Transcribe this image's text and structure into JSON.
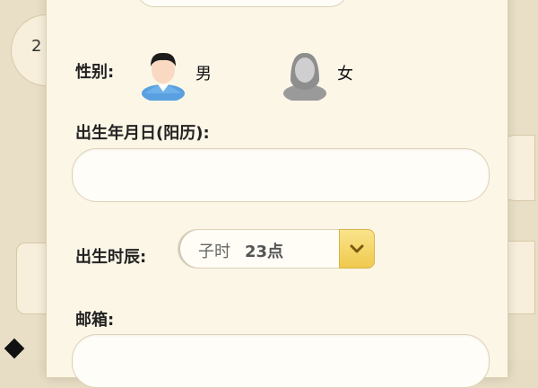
{
  "background": {
    "card_number": "2"
  },
  "form": {
    "gender_label": "性别:",
    "gender_options": [
      {
        "label": "男",
        "icon": "male-avatar-icon"
      },
      {
        "label": "女",
        "icon": "female-avatar-icon"
      }
    ],
    "birthdate_label": "出生年月日(阳历):",
    "birthdate_value": "",
    "birth_hour_label": "出生时辰:",
    "birth_hour_value": "子时",
    "birth_hour_detail": "23点",
    "email_label": "邮箱:",
    "email_value": ""
  },
  "colors": {
    "accent": "#f0c94e",
    "panel": "#fcf6e7"
  }
}
